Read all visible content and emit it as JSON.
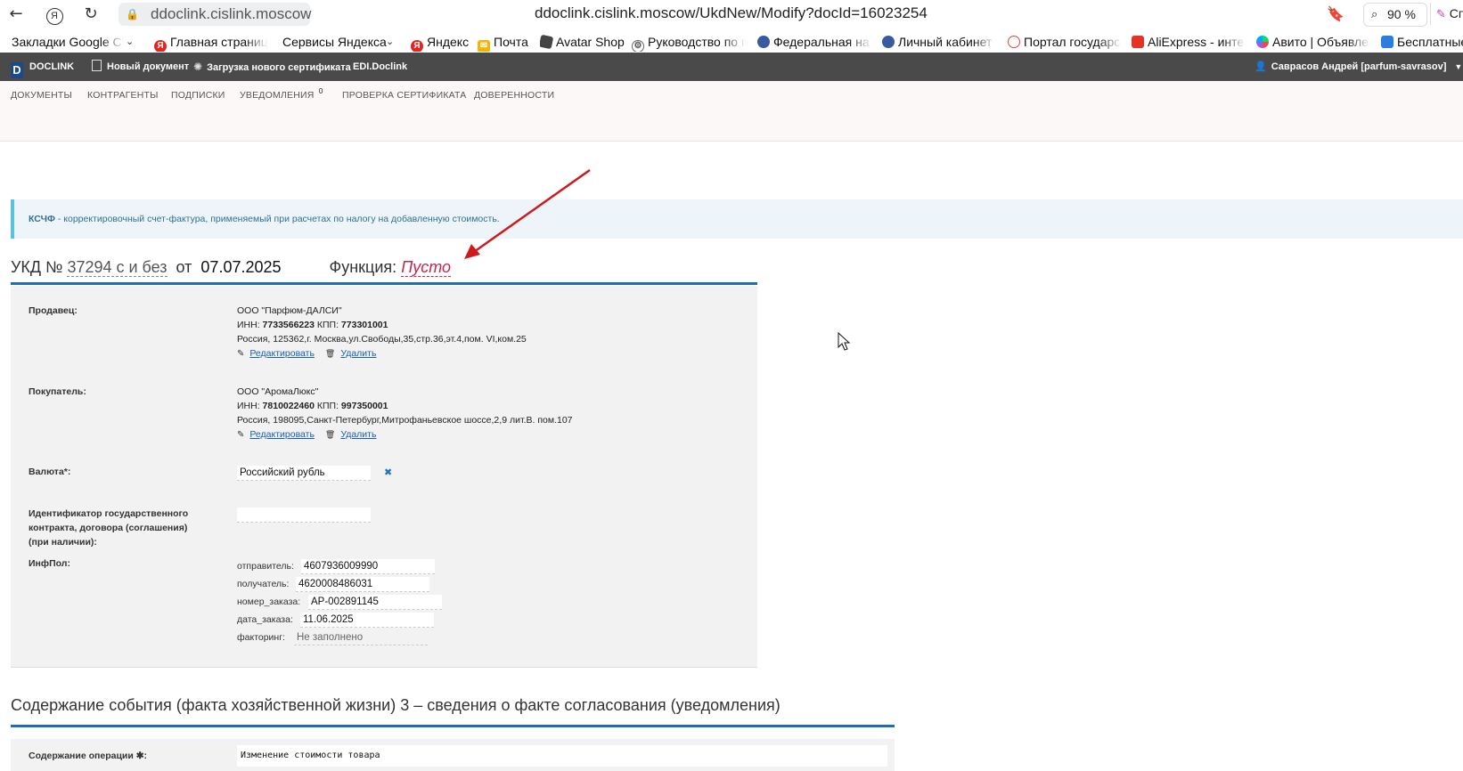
{
  "browser": {
    "domain_badge": "ddoclink.cislink.moscow",
    "url": "ddoclink.cislink.moscow/UkdNew/Modify?docId=16023254",
    "zoom": "90 %",
    "side_label": "Спр"
  },
  "bookmarks": [
    {
      "label": "Закладки Google Ch",
      "icon": "none"
    },
    {
      "label": "Главная страница",
      "icon": "yandex-icon"
    },
    {
      "label": "Сервисы Яндекса",
      "icon": "none"
    },
    {
      "label": "Яндекс",
      "icon": "yandex-icon"
    },
    {
      "label": "Почта",
      "icon": "mail-icon"
    },
    {
      "label": "Avatar Shop",
      "icon": "roblox-icon"
    },
    {
      "label": "Руководство по п",
      "icon": "gear-icon"
    },
    {
      "label": "Федеральная нал",
      "icon": "emblem-icon"
    },
    {
      "label": "Личный кабинет",
      "icon": "emblem-icon"
    },
    {
      "label": "Портал государс",
      "icon": "gosuslugi-icon"
    },
    {
      "label": "AliExpress - интер",
      "icon": "aliexpress-icon"
    },
    {
      "label": "Авито | Объявлен",
      "icon": "avito-icon"
    },
    {
      "label": "Бесплатные",
      "icon": "gift-icon"
    }
  ],
  "appbar": {
    "brand": "DOCLINK",
    "new_doc": "Новый документ",
    "upload_cert": "Загрузка нового сертификата",
    "edi": "EDI.Doclink",
    "user": "Саврасов Андрей [parfum-savrasov]"
  },
  "menu": {
    "documents": "ДОКУМЕНТЫ",
    "contractors": "КОНТРАГЕНТЫ",
    "signatures": "ПОДПИСКИ",
    "notifications": "УВЕДОМЛЕНИЯ",
    "notifications_count": "0",
    "cert_check": "ПРОВЕРКА СЕРТИФИКАТА",
    "powers": "ДОВЕРЕННОСТИ"
  },
  "banner": {
    "abbr": "КСЧФ",
    "text": " - корректировочный счет-фактура, применяемый при расчетах по налогу на добавленную стоимость."
  },
  "doc": {
    "prefix": "УКД №",
    "number": "37294 с и без",
    "from": "от",
    "date": "07.07.2025",
    "function_label": "Функция:",
    "function_value": "Пусто"
  },
  "form": {
    "seller_label": "Продавец:",
    "seller_name": "ООО \"Парфюм-ДАЛСИ\"",
    "seller_inn_label": "ИНН: ",
    "seller_inn": "7733566223",
    "seller_kpp_label": " КПП: ",
    "seller_kpp": "773301001",
    "seller_address": "Россия, 125362,г. Москва,ул.Свободы,35,стр.36,эт.4,пом. VI,ком.25",
    "edit": "Редактировать",
    "delete": "Удалить",
    "buyer_label": "Покупатель:",
    "buyer_name": "ООО \"АромаЛюкс\"",
    "buyer_inn_label": "ИНН: ",
    "buyer_inn": "7810022460",
    "buyer_kpp_label": " КПП: ",
    "buyer_kpp": "997350001",
    "buyer_address": "Россия, 198095,Санкт-Петербург,Митрофаньевское шоссе,2,9 лит.В. пом.107",
    "currency_label": "Валюта*:",
    "currency_value": "Российский рубль",
    "contract_id_label": "Идентификатор государственного контракта, договора (соглашения) (при наличии):",
    "contract_id_value": "",
    "infpol_label": "ИнфПол:",
    "infpol": [
      {
        "key": "отправитель:",
        "value": "4607936009990"
      },
      {
        "key": "получатель:",
        "value": "4620008486031"
      },
      {
        "key": "номер_заказа:",
        "value": "AP-002891145"
      },
      {
        "key": "дата_заказа:",
        "value": "11.06.2025"
      },
      {
        "key": "факторинг:",
        "value": "Не заполнено"
      }
    ]
  },
  "section3": {
    "title": "Содержание события (факта хозяйственной жизни) 3 – сведения о факте согласования (уведомления)",
    "operation_label": "Содержание операции ✱:",
    "operation_value": "Изменение стоимости товара"
  },
  "colors": {
    "accent_blue": "#1f6db5",
    "function_empty": "#c7254e",
    "annotation_arrow": "#d0191c",
    "appbar_bg": "#4a4a4a"
  }
}
